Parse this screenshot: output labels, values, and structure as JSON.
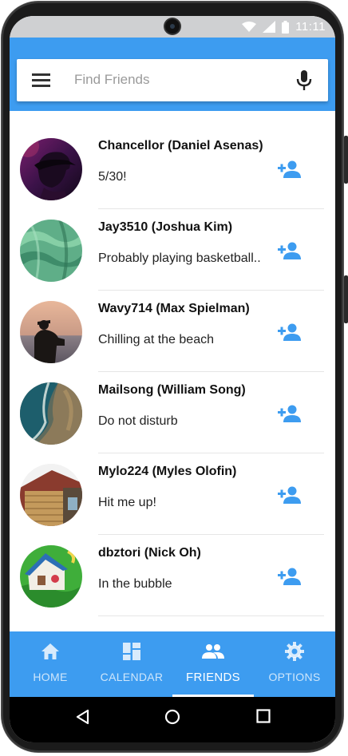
{
  "status_bar": {
    "time": "11:11",
    "icons": [
      "wifi-icon",
      "signal-icon",
      "battery-icon"
    ]
  },
  "search": {
    "placeholder": "Find Friends",
    "value": ""
  },
  "friends": [
    {
      "name": "Chancellor (Daniel Asenas)",
      "status": "5/30!",
      "avatar": "avatar-purple-portrait"
    },
    {
      "name": "Jay3510 (Joshua Kim)",
      "status": "Probably playing basketball..",
      "avatar": "avatar-green-fabric"
    },
    {
      "name": "Wavy714 (Max Spielman)",
      "status": "Chilling at the beach",
      "avatar": "avatar-beach-silhouette"
    },
    {
      "name": "Mailsong (William Song)",
      "status": "Do not disturb",
      "avatar": "avatar-aerial-coast"
    },
    {
      "name": "Mylo224 (Myles Olofin)",
      "status": "Hit me up!",
      "avatar": "avatar-wooden-house"
    },
    {
      "name": "dbztori (Nick Oh)",
      "status": "In the bubble",
      "avatar": "avatar-cartoon-house"
    }
  ],
  "bottom_nav": {
    "items": [
      {
        "label": "HOME",
        "icon": "home-icon"
      },
      {
        "label": "CALENDAR",
        "icon": "dashboard-icon"
      },
      {
        "label": "FRIENDS",
        "icon": "people-icon"
      },
      {
        "label": "OPTIONS",
        "icon": "gear-icon"
      }
    ],
    "active": "FRIENDS"
  },
  "system_nav": [
    "back-icon",
    "home-circle-icon",
    "recents-icon"
  ],
  "colors": {
    "primary": "#3d9cf0",
    "add_icon": "#3d9cf0",
    "nav_bg": "#3d9cf0",
    "system_bar": "#000000"
  }
}
